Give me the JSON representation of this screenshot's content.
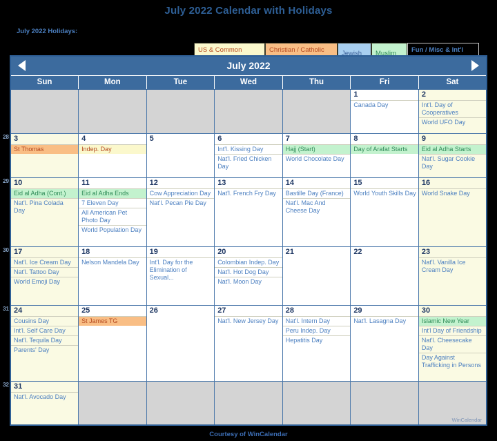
{
  "page": {
    "title": "July 2022 Calendar with Holidays",
    "holidays_label": "July 2022 Holidays:",
    "footer": "Courtesy of WinCalendar",
    "watermark": "WinCalendar"
  },
  "legend": {
    "items": [
      {
        "label": "US & Common",
        "key": "us"
      },
      {
        "label": "Christian / Catholic",
        "key": "chr"
      },
      {
        "label": "Jewish",
        "key": "jew"
      },
      {
        "label": "Muslim",
        "key": "mus"
      },
      {
        "label": "Fun / Misc & Int'l",
        "key": "fun"
      }
    ]
  },
  "calendar": {
    "month_title": "July 2022",
    "prev_label": "◀",
    "next_label": "▶",
    "day_headers": [
      "Sun",
      "Mon",
      "Tue",
      "Wed",
      "Thu",
      "Fri",
      "Sat"
    ],
    "week_numbers": [
      "",
      "28",
      "29",
      "30",
      "31",
      "32"
    ],
    "weeks": [
      [
        {
          "blank": true
        },
        {
          "blank": true
        },
        {
          "blank": true
        },
        {
          "blank": true
        },
        {
          "blank": true
        },
        {
          "num": "1",
          "events": [
            {
              "text": "Canada Day",
              "cat": "fun"
            }
          ]
        },
        {
          "num": "2",
          "events": [
            {
              "text": "Int'l. Day of Cooperatives",
              "cat": "fun"
            },
            {
              "text": "World UFO Day",
              "cat": "fun"
            }
          ]
        }
      ],
      [
        {
          "num": "3",
          "events": [
            {
              "text": "St Thomas",
              "cat": "chr"
            }
          ]
        },
        {
          "num": "4",
          "events": [
            {
              "text": "Indep. Day",
              "cat": "us"
            }
          ]
        },
        {
          "num": "5",
          "events": []
        },
        {
          "num": "6",
          "events": [
            {
              "text": "Int'l. Kissing Day",
              "cat": "fun"
            },
            {
              "text": "Nat'l. Fried Chicken Day",
              "cat": "fun"
            }
          ]
        },
        {
          "num": "7",
          "events": [
            {
              "text": "Hajj (Start)",
              "cat": "mus"
            },
            {
              "text": "World Chocolate Day",
              "cat": "fun"
            }
          ]
        },
        {
          "num": "8",
          "events": [
            {
              "text": "Day of Arafat Starts",
              "cat": "mus"
            }
          ]
        },
        {
          "num": "9",
          "events": [
            {
              "text": "Eid al Adha Starts",
              "cat": "mus"
            },
            {
              "text": "Nat'l. Sugar Cookie Day",
              "cat": "fun"
            }
          ]
        }
      ],
      [
        {
          "num": "10",
          "events": [
            {
              "text": "Eid al Adha (Cont.)",
              "cat": "mus"
            },
            {
              "text": "Nat'l. Pina Colada Day",
              "cat": "fun"
            }
          ]
        },
        {
          "num": "11",
          "events": [
            {
              "text": "Eid al Adha Ends",
              "cat": "mus"
            },
            {
              "text": "7 Eleven Day",
              "cat": "fun"
            },
            {
              "text": "All American Pet Photo Day",
              "cat": "fun"
            },
            {
              "text": "World Population Day",
              "cat": "fun"
            }
          ]
        },
        {
          "num": "12",
          "events": [
            {
              "text": "Cow Appreciation Day",
              "cat": "fun"
            },
            {
              "text": "Nat'l. Pecan Pie Day",
              "cat": "fun"
            }
          ]
        },
        {
          "num": "13",
          "events": [
            {
              "text": "Nat'l. French Fry Day",
              "cat": "fun"
            }
          ]
        },
        {
          "num": "14",
          "events": [
            {
              "text": "Bastille Day (France)",
              "cat": "fun"
            },
            {
              "text": "Nat'l. Mac And Cheese Day",
              "cat": "fun"
            }
          ]
        },
        {
          "num": "15",
          "events": [
            {
              "text": "World Youth Skills Day",
              "cat": "fun"
            }
          ]
        },
        {
          "num": "16",
          "events": [
            {
              "text": "World Snake Day",
              "cat": "fun"
            }
          ]
        }
      ],
      [
        {
          "num": "17",
          "events": [
            {
              "text": "Nat'l. Ice Cream Day",
              "cat": "fun"
            },
            {
              "text": "Nat'l. Tattoo Day",
              "cat": "fun"
            },
            {
              "text": "World Emoji Day",
              "cat": "fun"
            }
          ]
        },
        {
          "num": "18",
          "events": [
            {
              "text": "Nelson Mandela Day",
              "cat": "fun"
            }
          ]
        },
        {
          "num": "19",
          "events": [
            {
              "text": "Int'l. Day for the Elimination of Sexual...",
              "cat": "fun"
            }
          ]
        },
        {
          "num": "20",
          "events": [
            {
              "text": "Colombian Indep. Day",
              "cat": "fun"
            },
            {
              "text": "Nat'l. Hot Dog Day",
              "cat": "fun"
            },
            {
              "text": "Nat'l. Moon Day",
              "cat": "fun"
            }
          ]
        },
        {
          "num": "21",
          "events": []
        },
        {
          "num": "22",
          "events": []
        },
        {
          "num": "23",
          "events": [
            {
              "text": "Nat'l. Vanilla Ice Cream Day",
              "cat": "fun"
            }
          ]
        }
      ],
      [
        {
          "num": "24",
          "events": [
            {
              "text": "Cousins Day",
              "cat": "fun"
            },
            {
              "text": "Int'l. Self Care Day",
              "cat": "fun"
            },
            {
              "text": "Nat'l. Tequila Day",
              "cat": "fun"
            },
            {
              "text": "Parents' Day",
              "cat": "fun"
            }
          ]
        },
        {
          "num": "25",
          "events": [
            {
              "text": "St James TG",
              "cat": "chr"
            }
          ]
        },
        {
          "num": "26",
          "events": []
        },
        {
          "num": "27",
          "events": [
            {
              "text": "Nat'l. New Jersey Day",
              "cat": "fun"
            }
          ]
        },
        {
          "num": "28",
          "events": [
            {
              "text": "Nat'l. Intern Day",
              "cat": "fun"
            },
            {
              "text": "Peru Indep. Day",
              "cat": "fun"
            },
            {
              "text": "Hepatitis Day",
              "cat": "fun"
            }
          ]
        },
        {
          "num": "29",
          "events": [
            {
              "text": "Nat'l. Lasagna Day",
              "cat": "fun"
            }
          ]
        },
        {
          "num": "30",
          "events": [
            {
              "text": "Islamic New Year",
              "cat": "mus"
            },
            {
              "text": "Int'l Day of Friendship",
              "cat": "fun"
            },
            {
              "text": "Nat'l. Cheesecake Day",
              "cat": "fun"
            },
            {
              "text": "Day Against Trafficking in Persons",
              "cat": "fun"
            }
          ]
        }
      ],
      [
        {
          "num": "31",
          "events": [
            {
              "text": "Nat'l. Avocado Day",
              "cat": "fun"
            }
          ]
        },
        {
          "blank": true
        },
        {
          "blank": true
        },
        {
          "blank": true
        },
        {
          "blank": true
        },
        {
          "blank": true
        },
        {
          "blank": true
        }
      ]
    ]
  },
  "colors": {
    "title": "#2E5F96",
    "header_bar": "#3C6B9E",
    "weekend_bg": "#FAFAE3",
    "blank_bg": "#D4D4D4",
    "us": "#FBF8CC",
    "christian": "#F9BE85",
    "jewish": "#A8CFF0",
    "muslim": "#C3F2CE",
    "event_text": "#4B7FC0"
  }
}
